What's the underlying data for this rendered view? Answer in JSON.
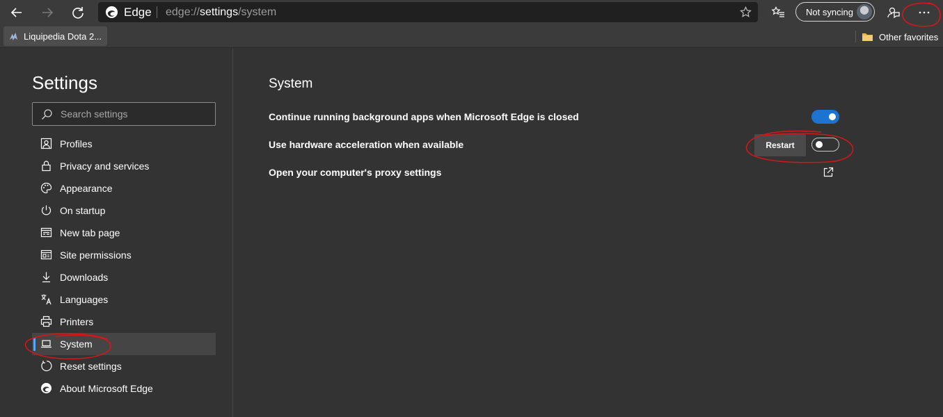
{
  "toolbar": {
    "back_icon": "back-arrow-icon",
    "forward_icon": "forward-arrow-icon",
    "refresh_icon": "refresh-icon",
    "address": {
      "brand": "Edge",
      "url_prefix": "edge://",
      "url_host": "settings",
      "url_path": "/system"
    },
    "sync_label": "Not syncing",
    "more_icon": "more-dots-icon"
  },
  "favorites": {
    "tab_label": "Liquipedia Dota 2...",
    "other_label": "Other favorites"
  },
  "sidebar": {
    "title": "Settings",
    "search_placeholder": "Search settings",
    "items": [
      {
        "label": "Profiles",
        "icon": "profile-icon"
      },
      {
        "label": "Privacy and services",
        "icon": "lock-icon"
      },
      {
        "label": "Appearance",
        "icon": "palette-icon"
      },
      {
        "label": "On startup",
        "icon": "power-icon"
      },
      {
        "label": "New tab page",
        "icon": "new-tab-icon"
      },
      {
        "label": "Site permissions",
        "icon": "site-permissions-icon"
      },
      {
        "label": "Downloads",
        "icon": "download-icon"
      },
      {
        "label": "Languages",
        "icon": "languages-icon"
      },
      {
        "label": "Printers",
        "icon": "printer-icon"
      },
      {
        "label": "System",
        "icon": "laptop-icon",
        "active": true
      },
      {
        "label": "Reset settings",
        "icon": "reset-icon"
      },
      {
        "label": "About Microsoft Edge",
        "icon": "edge-logo-icon"
      }
    ]
  },
  "main": {
    "title": "System",
    "rows": [
      {
        "label": "Continue running background apps when Microsoft Edge is closed",
        "toggle": true
      },
      {
        "label": "Use hardware acceleration when available",
        "toggle": false,
        "button": "Restart"
      },
      {
        "label": "Open your computer's proxy settings",
        "external_link": true
      }
    ]
  },
  "colors": {
    "background": "#333333",
    "toolbar": "#3b3b3b",
    "accent": "#1d74d0",
    "active_indicator": "#5aa8ff",
    "annotation": "#d01818"
  }
}
